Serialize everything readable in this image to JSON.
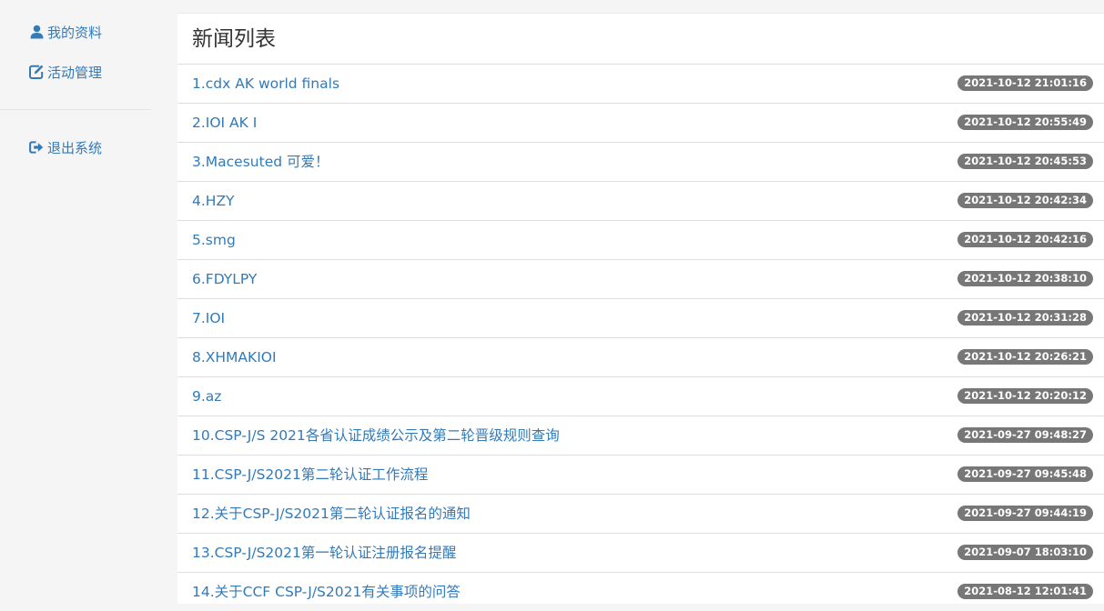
{
  "sidebar": {
    "items": [
      {
        "label": "我的资料",
        "icon": "user-icon"
      },
      {
        "label": "活动管理",
        "icon": "edit-icon"
      },
      {
        "label": "退出系统",
        "icon": "logout-icon"
      }
    ]
  },
  "main": {
    "title": "新闻列表",
    "news": [
      {
        "title": "1.cdx AK world finals",
        "time": "2021-10-12 21:01:16"
      },
      {
        "title": "2.IOI AK I",
        "time": "2021-10-12 20:55:49"
      },
      {
        "title": "3.Macesuted 可爱！",
        "time": "2021-10-12 20:45:53"
      },
      {
        "title": "4.HZY",
        "time": "2021-10-12 20:42:34"
      },
      {
        "title": "5.smg",
        "time": "2021-10-12 20:42:16"
      },
      {
        "title": "6.FDYLPY",
        "time": "2021-10-12 20:38:10"
      },
      {
        "title": "7.IOI",
        "time": "2021-10-12 20:31:28"
      },
      {
        "title": "8.XHMAKIOI",
        "time": "2021-10-12 20:26:21"
      },
      {
        "title": "9.az",
        "time": "2021-10-12 20:20:12"
      },
      {
        "title": "10.CSP-J/S 2021各省认证成绩公示及第二轮晋级规则查询",
        "time": "2021-09-27 09:48:27"
      },
      {
        "title": "11.CSP-J/S2021第二轮认证工作流程",
        "time": "2021-09-27 09:45:48"
      },
      {
        "title": "12.关于CSP-J/S2021第二轮认证报名的通知",
        "time": "2021-09-27 09:44:19"
      },
      {
        "title": "13.CSP-J/S2021第一轮认证注册报名提醒",
        "time": "2021-09-07 18:03:10"
      },
      {
        "title": "14.关于CCF CSP-J/S2021有关事项的问答",
        "time": "2021-08-12 12:01:41"
      }
    ]
  },
  "colors": {
    "link": "#337ab7",
    "badge_bg": "#777777",
    "page_bg": "#f5f5f5"
  }
}
